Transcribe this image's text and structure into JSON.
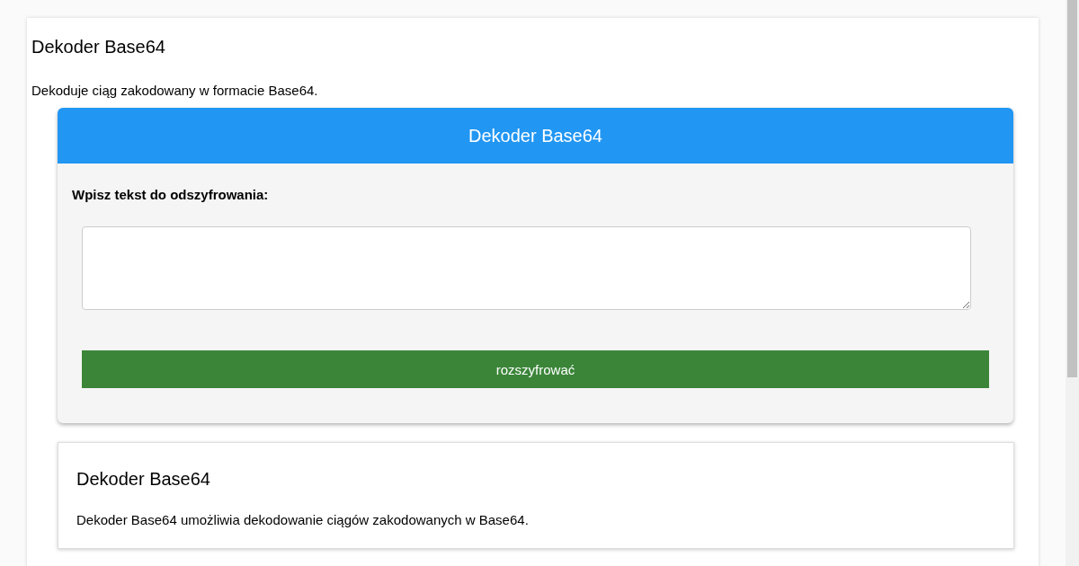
{
  "page": {
    "title": "Dekoder Base64",
    "description": "Dekoduje ciąg zakodowany w formacie Base64."
  },
  "tool": {
    "header": "Dekoder Base64",
    "input_label": "Wpisz tekst do odszyfrowania:",
    "button": "rozszyfrować"
  },
  "info": {
    "title": "Dekoder Base64",
    "text": "Dekoder Base64 umożliwia dekodowanie ciągów zakodowanych w Base64."
  }
}
